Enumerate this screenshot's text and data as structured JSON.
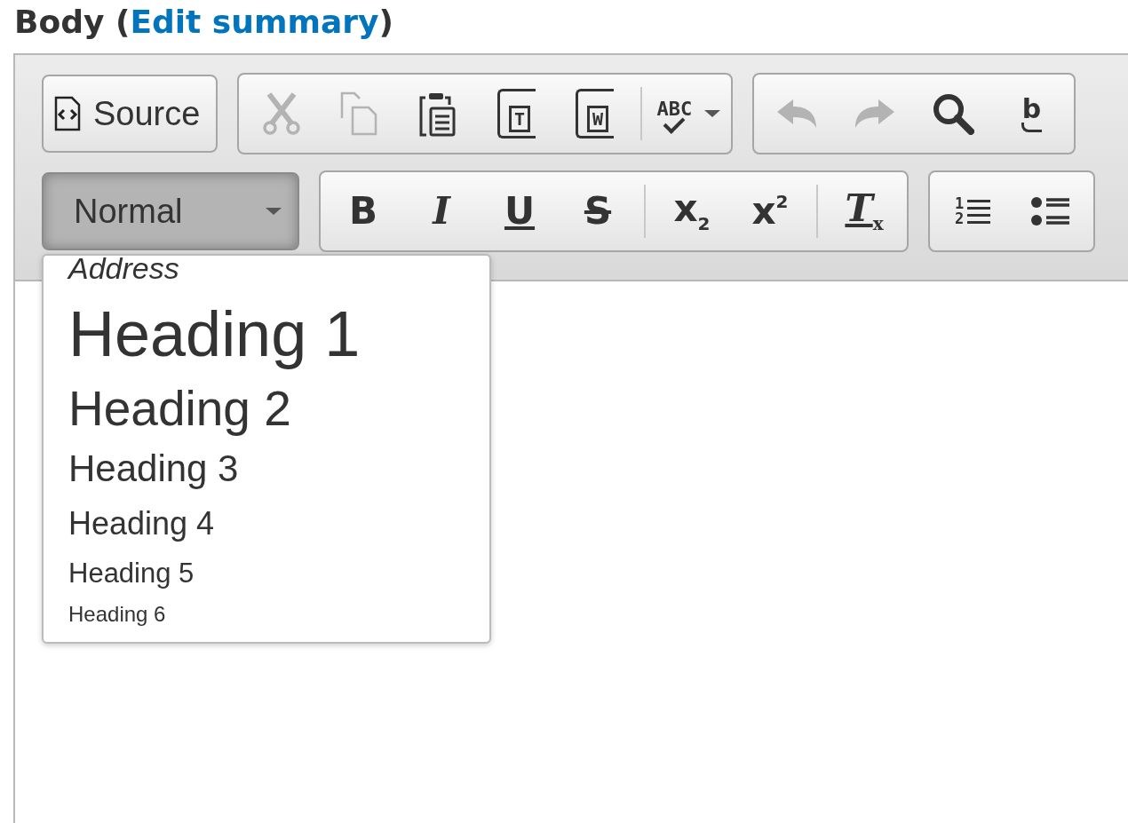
{
  "heading": [
    {
      "kind": "text",
      "text": "Body ("
    },
    {
      "kind": "link",
      "text": "Edit summary"
    },
    {
      "kind": "text",
      "text": ")"
    }
  ],
  "toolbar_rows": [
    [
      {
        "items": [
          {
            "kind": "source",
            "label": "Source",
            "disabled": false
          }
        ]
      },
      {
        "items": [
          {
            "kind": "cut",
            "disabled": true
          },
          {
            "kind": "copy",
            "disabled": true
          },
          {
            "kind": "paste",
            "disabled": false
          },
          {
            "kind": "paste-text",
            "glyph": "T",
            "disabled": false
          },
          {
            "kind": "paste-word",
            "glyph": "W",
            "disabled": false
          },
          {
            "kind": "separator"
          },
          {
            "kind": "spellcheck",
            "glyph": "ABC",
            "disabled": false
          }
        ]
      },
      {
        "items": [
          {
            "kind": "undo",
            "disabled": true
          },
          {
            "kind": "redo",
            "disabled": true
          },
          {
            "kind": "find",
            "disabled": false
          },
          {
            "kind": "replace",
            "glyph": "b",
            "disabled": false
          }
        ]
      }
    ],
    [
      {
        "combo": {
          "value": "Normal",
          "pressed": true
        }
      },
      {
        "items": [
          {
            "kind": "bold",
            "glyph": "B",
            "disabled": false
          },
          {
            "kind": "italic",
            "glyph": "I",
            "disabled": false
          },
          {
            "kind": "underline",
            "glyph": "U",
            "disabled": false
          },
          {
            "kind": "strike",
            "glyph": "S",
            "disabled": false
          },
          {
            "kind": "separator"
          },
          {
            "kind": "subscript",
            "glyph": "x",
            "index": "2",
            "disabled": false
          },
          {
            "kind": "superscript",
            "glyph": "x",
            "index": "2",
            "disabled": false
          },
          {
            "kind": "separator"
          },
          {
            "kind": "remove-format",
            "glyph": "T",
            "index": "x",
            "disabled": false
          }
        ]
      },
      {
        "items": [
          {
            "kind": "numbered-list",
            "marks": [
              "1",
              "2"
            ],
            "disabled": false
          },
          {
            "kind": "bulleted-list",
            "disabled": false
          }
        ]
      }
    ]
  ],
  "format_menu": [
    {
      "kind": "address",
      "label": "Address"
    },
    {
      "kind": "h1",
      "label": "Heading 1"
    },
    {
      "kind": "h2",
      "label": "Heading 2"
    },
    {
      "kind": "h3",
      "label": "Heading 3"
    },
    {
      "kind": "h4",
      "label": "Heading 4"
    },
    {
      "kind": "h5",
      "label": "Heading 5"
    },
    {
      "kind": "h6",
      "label": "Heading 6"
    }
  ]
}
